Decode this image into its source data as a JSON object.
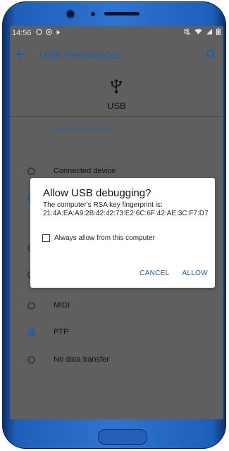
{
  "status_bar": {
    "time": "14:56",
    "left_icons": [
      "notification-icon",
      "chrome-icon",
      "play-icon"
    ],
    "right_icons": [
      "mute-icon",
      "wifi-icon",
      "signal-icon",
      "battery-icon"
    ]
  },
  "app_bar": {
    "title": "USB Preferences",
    "back_icon": "back-arrow-icon",
    "search_icon": "search-icon"
  },
  "header": {
    "title": "USB",
    "icon": "usb-icon"
  },
  "section": {
    "label": "USB CONTROLLED BY"
  },
  "options": [
    {
      "label": "Connected device",
      "selected": false
    },
    {
      "label": "MIDI",
      "selected": false
    },
    {
      "label": "PTP",
      "selected": true
    },
    {
      "label": "No data transfer",
      "selected": false
    }
  ],
  "dialog": {
    "title": "Allow USB debugging?",
    "body": "The computer's RSA key fingerprint is: 21:4A:EA:A9:2B:42:42:73:E2:6C:6F:42:AE:3C:F7:D7",
    "checkbox_label": "Always allow from this computer",
    "checkbox_checked": false,
    "cancel_label": "CANCEL",
    "allow_label": "ALLOW"
  }
}
